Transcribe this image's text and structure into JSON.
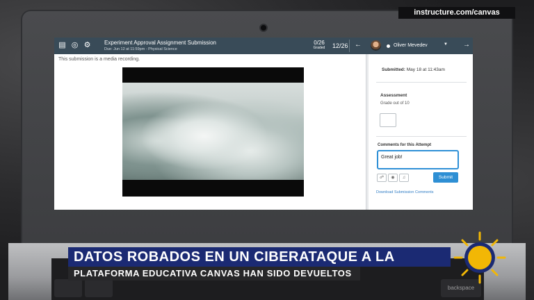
{
  "watermark": "instructure.com/canvas",
  "canvas": {
    "header": {
      "icons": [
        "menu-icon",
        "eye-icon",
        "gear-icon"
      ],
      "assignment_title": "Experiment Approval Assignment Submission",
      "due_text": "Due: Jun 12 at 11:59pm - Physical Science",
      "graded_count": "0/26",
      "graded_label": "Graded",
      "student_position": "12/26",
      "student_name": "Oliver Mevedev"
    },
    "submission_message": "This submission is a media recording.",
    "panel": {
      "submitted_label": "Submitted:",
      "submitted_value": "May 18 at 11:43am",
      "assessment_label": "Assessment",
      "grade_out_of": "Grade out of 10",
      "comments_label": "Comments for this Attempt",
      "comment_value": "Great job!",
      "submit_label": "Submit",
      "download_link": "Download Submission Comments"
    }
  },
  "news": {
    "headline_line1": "DATOS ROBADOS EN UN CIBERATAQUE A LA",
    "headline_line2": "PLATAFORMA EDUCATIVA CANVAS HAN SIDO DEVUELTOS",
    "logo_color": "#f2b705"
  },
  "keyboard": {
    "key_label": "backspace"
  }
}
